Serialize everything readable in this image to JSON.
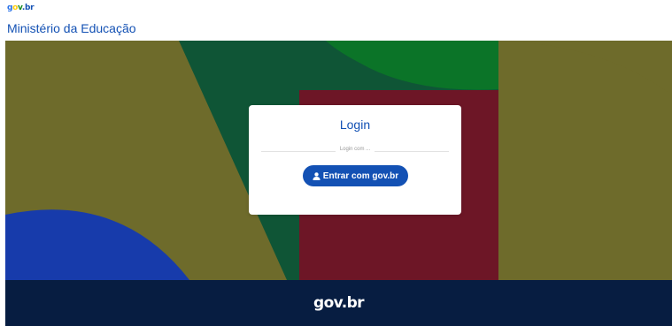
{
  "header": {
    "logo": {
      "part1": "gov",
      "part2": ".br",
      "colors": {
        "g": "#2670e8",
        "o": "#ffcd07",
        "v": "#168821",
        "dot": "#1351b4",
        "br": "#1351b4"
      }
    },
    "ministry_title": "Ministério da Educação"
  },
  "login_card": {
    "title": "Login",
    "divider_text": "Login com ...",
    "govbr_button": {
      "icon": "user-icon",
      "label": "Entrar com gov.br"
    }
  },
  "footer": {
    "logo_text": "gov.br"
  },
  "colors": {
    "primary": "#1351b4",
    "footer_bg": "#071d41",
    "hero_olive": "#6e6b2b",
    "hero_dark_green": "#0f5536",
    "hero_green": "#0b7428",
    "hero_maroon": "#6d1626",
    "hero_blue": "#173bab"
  }
}
